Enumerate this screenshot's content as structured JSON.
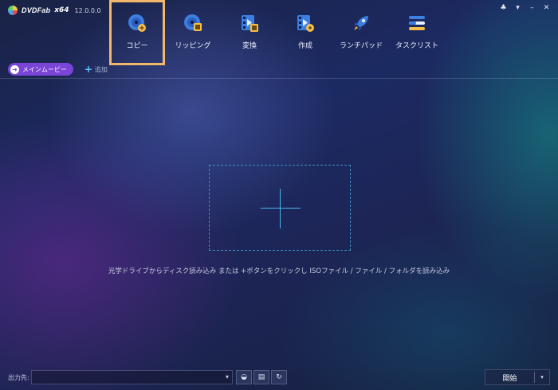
{
  "app": {
    "logo_text": "DVDFab",
    "edition": "x64",
    "version": "12.0.0.0"
  },
  "window_controls": [
    "shirt-icon",
    "pin-icon",
    "minimize-icon",
    "close-icon"
  ],
  "nav": {
    "items": [
      {
        "label": "コピー",
        "icon": "disc-copy-icon",
        "active": true
      },
      {
        "label": "リッピング",
        "icon": "disc-rip-icon",
        "active": false
      },
      {
        "label": "変換",
        "icon": "film-convert-icon",
        "active": false
      },
      {
        "label": "作成",
        "icon": "film-create-icon",
        "active": false
      },
      {
        "label": "ランチパッド",
        "icon": "rocket-icon",
        "active": false
      },
      {
        "label": "タスクリスト",
        "icon": "task-list-icon",
        "active": false
      }
    ],
    "active_outline_color": "#f1b86b"
  },
  "tabs": {
    "current": "メインムービー",
    "add_label": "追加"
  },
  "main": {
    "hint": "光学ドライブからディスク読み込み または +ボタンをクリックし ISOファイル / ファイル / フォルダを読み込み"
  },
  "bottom": {
    "output_label": "出力先:",
    "output_value": "",
    "start_label": "開始"
  },
  "colors": {
    "accent_purple": "#7a44d6",
    "accent_blue": "#4bb6f0"
  }
}
